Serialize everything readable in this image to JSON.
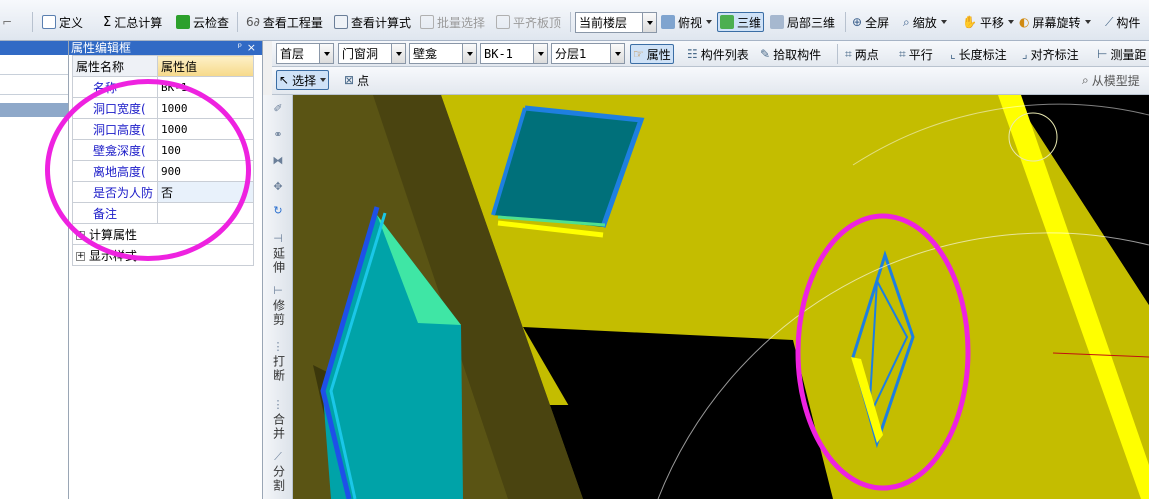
{
  "toolbar": {
    "define": "定义",
    "summary_calc": "汇总计算",
    "cloud_check": "云检查",
    "view_quantity": "查看工程量",
    "view_formula": "查看计算式",
    "batch_select": "批量选择",
    "flush_slab": "平齐板顶",
    "current_floor": "当前楼层",
    "top_view": "俯视",
    "three_d": "三维",
    "local_three_d": "局部三维",
    "fullscreen": "全屏",
    "zoom": "缩放",
    "pan": "平移",
    "screen_rotate": "屏幕旋转",
    "component": "构件"
  },
  "property_panel": {
    "title": "属性编辑框",
    "pin": "ᵖ",
    "close": "×",
    "col_name": "属性名称",
    "col_value": "属性值",
    "rows": [
      {
        "name": "名称",
        "value": "BK-1"
      },
      {
        "name": "洞口宽度(",
        "value": "1000"
      },
      {
        "name": "洞口高度(",
        "value": "1000"
      },
      {
        "name": "壁龛深度(",
        "value": "100"
      },
      {
        "name": "离地高度(",
        "value": "900"
      },
      {
        "name": "是否为人防",
        "value": "否"
      },
      {
        "name": "备注",
        "value": ""
      }
    ],
    "groups": [
      "计算属性",
      "显示样式"
    ]
  },
  "toolbar2": {
    "floor": "首层",
    "category": "门窗洞",
    "type": "壁龛",
    "component": "BK-1",
    "layer": "分层1",
    "properties": "属性",
    "component_list": "构件列表",
    "pick_component": "拾取构件",
    "two_points": "两点",
    "parallel": "平行",
    "length_dim": "长度标注",
    "aligned_dim": "对齐标注",
    "measure": "测量距"
  },
  "toolbar3": {
    "select": "选择",
    "point": "点",
    "from_model": "从模型提"
  },
  "vertical_tools": [
    "延伸",
    "修剪",
    "打断",
    "合并",
    "分割"
  ],
  "colors": {
    "slab": "#c4bd00",
    "column": "#5a5414",
    "opening_fill": "#00868a",
    "opening_edge": "#1e7fe0",
    "highlight_yellow": "#ffff00",
    "annotation": "#ee22e0",
    "panel_title": "#316ac5"
  }
}
